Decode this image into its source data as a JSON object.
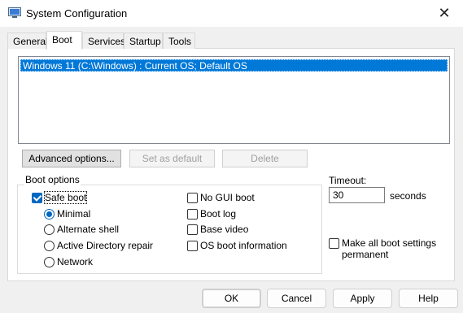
{
  "window": {
    "title": "System Configuration",
    "icon": "msconfig-icon"
  },
  "tabs": [
    {
      "label": "General",
      "active": false
    },
    {
      "label": "Boot",
      "active": true
    },
    {
      "label": "Services",
      "active": false
    },
    {
      "label": "Startup",
      "active": false
    },
    {
      "label": "Tools",
      "active": false
    }
  ],
  "os_list": {
    "items": [
      "Windows 11 (C:\\Windows) : Current OS; Default OS"
    ],
    "selected_index": 0
  },
  "buttons": {
    "advanced": "Advanced options...",
    "set_default": "Set as default",
    "delete": "Delete",
    "ok": "OK",
    "cancel": "Cancel",
    "apply": "Apply",
    "help": "Help"
  },
  "boot_options": {
    "group_label": "Boot options",
    "safe_boot": {
      "label": "Safe boot",
      "checked": true
    },
    "minimal": {
      "label": "Minimal",
      "selected": true
    },
    "alternate_shell": {
      "label": "Alternate shell",
      "selected": false
    },
    "active_directory": {
      "label": "Active Directory repair",
      "selected": false
    },
    "network": {
      "label": "Network",
      "selected": false
    },
    "no_gui": {
      "label": "No GUI boot",
      "checked": false
    },
    "boot_log": {
      "label": "Boot log",
      "checked": false
    },
    "base_video": {
      "label": "Base video",
      "checked": false
    },
    "os_boot_info": {
      "label": "OS boot information",
      "checked": false
    }
  },
  "timeout": {
    "label": "Timeout:",
    "value": "30",
    "unit": "seconds"
  },
  "make_permanent": {
    "label_line1": "Make all boot settings",
    "label_line2": "permanent",
    "checked": false
  },
  "colors": {
    "selection": "#0078d7",
    "accent": "#0067c0"
  }
}
